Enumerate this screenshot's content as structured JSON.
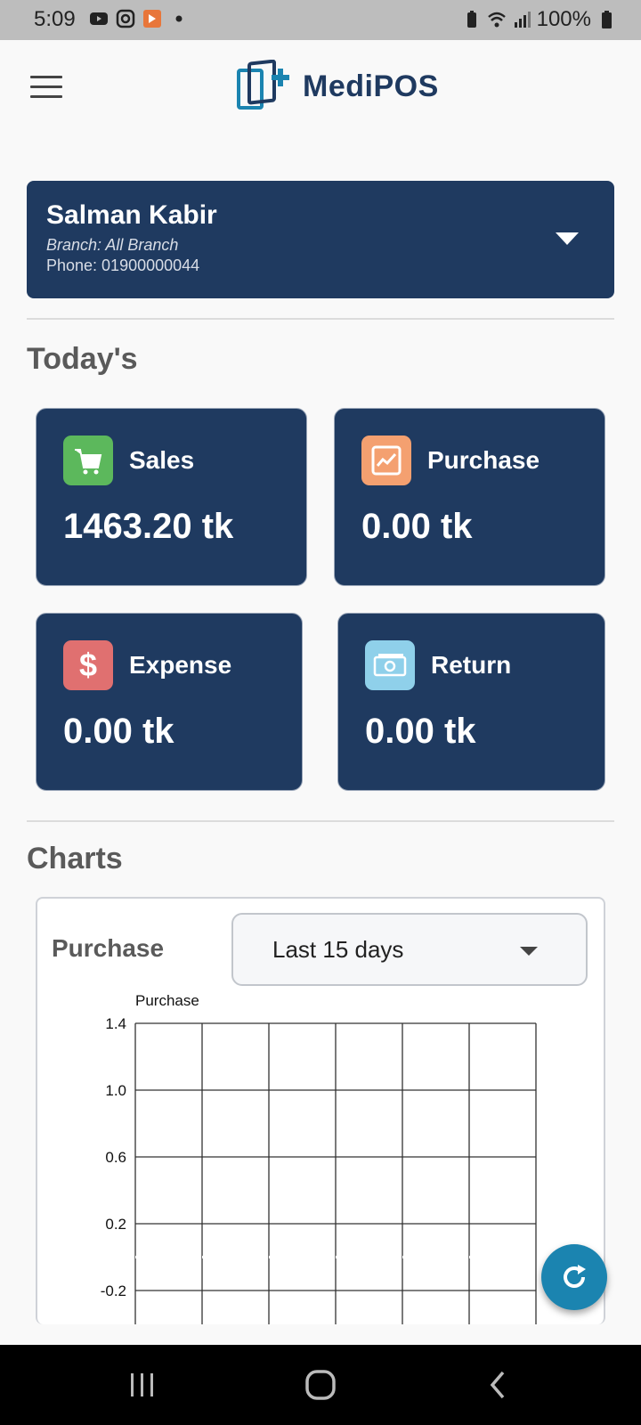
{
  "status_bar": {
    "time": "5:09",
    "battery": "100%",
    "icons_left": [
      "youtube-icon",
      "instagram-icon",
      "app-icon",
      "dot-icon"
    ],
    "icons_right": [
      "battery-saver-icon",
      "wifi-icon",
      "signal-icon",
      "battery-icon"
    ]
  },
  "app_bar": {
    "logo_text": "MediPOS",
    "menu_icon": "hamburger-menu-icon"
  },
  "user": {
    "name": "Salman Kabir",
    "branch": "Branch: All Branch",
    "phone": "Phone: 01900000044"
  },
  "todays": {
    "title": "Today's",
    "cards": [
      {
        "label": "Sales",
        "value": "1463.20 tk",
        "icon": "cart-icon",
        "icon_color": "#5cb85c"
      },
      {
        "label": "Purchase",
        "value": "0.00 tk",
        "icon": "trending-up-icon",
        "icon_color": "#f4a070"
      },
      {
        "label": "Expense",
        "value": "0.00 tk",
        "icon": "dollar-icon",
        "icon_color": "#e07070"
      },
      {
        "label": "Return",
        "value": "0.00 tk",
        "icon": "cash-icon",
        "icon_color": "#8fd0ea"
      }
    ]
  },
  "charts": {
    "title": "Charts",
    "label": "Purchase",
    "range": "Last 15 days"
  },
  "chart_data": {
    "type": "line",
    "ylabel": "Purchase",
    "y_ticks": [
      "1.4",
      "1.0",
      "0.6",
      "0.2",
      "-0.2"
    ],
    "ylim": [
      -0.2,
      1.4
    ],
    "grid": true,
    "series": [
      {
        "values": [
          0,
          0,
          0,
          0,
          0,
          0,
          0
        ]
      }
    ]
  },
  "colors": {
    "primary": "#1f3a60",
    "fab": "#1b84b0"
  },
  "fab_icon": "refresh-icon",
  "nav_icons": [
    "recents-icon",
    "home-icon",
    "back-icon"
  ]
}
